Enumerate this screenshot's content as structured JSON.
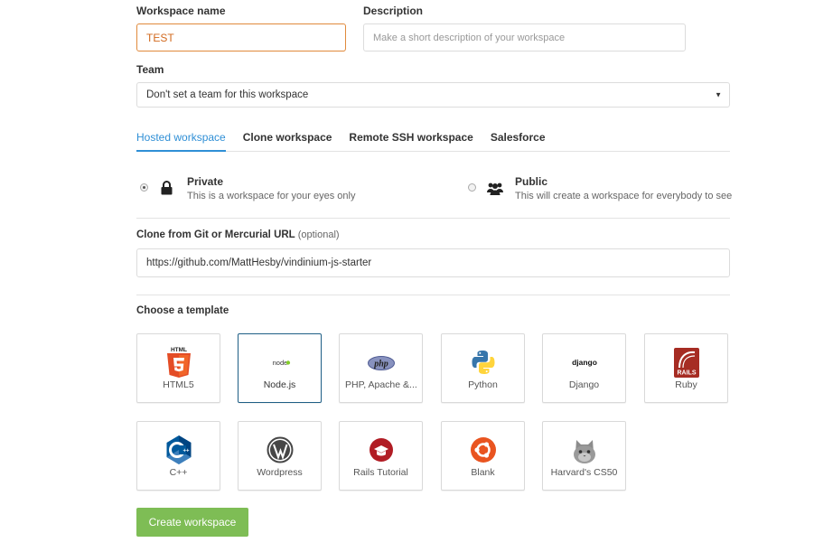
{
  "form": {
    "workspace_name_label": "Workspace name",
    "workspace_name_value": "TEST",
    "description_label": "Description",
    "description_placeholder": "Make a short description of your workspace",
    "team_label": "Team",
    "team_value": "Don't set a team for this workspace"
  },
  "tabs": [
    {
      "label": "Hosted workspace",
      "active": true
    },
    {
      "label": "Clone workspace",
      "active": false
    },
    {
      "label": "Remote SSH workspace",
      "active": false
    },
    {
      "label": "Salesforce",
      "active": false
    }
  ],
  "visibility": {
    "private": {
      "title": "Private",
      "desc": "This is a workspace for your eyes only",
      "icon": "lock-icon",
      "checked": true
    },
    "public": {
      "title": "Public",
      "desc": "This will create a workspace for everybody to see",
      "icon": "users-icon",
      "checked": false
    }
  },
  "clone": {
    "label": "Clone from Git or Mercurial URL",
    "optional": "(optional)",
    "value": "https://github.com/MattHesby/vindinium-js-starter"
  },
  "templates": {
    "label": "Choose a template",
    "items": [
      {
        "name": "HTML5",
        "icon": "html5-icon",
        "selected": false
      },
      {
        "name": "Node.js",
        "icon": "nodejs-icon",
        "selected": true
      },
      {
        "name": "PHP, Apache &...",
        "icon": "php-icon",
        "selected": false
      },
      {
        "name": "Python",
        "icon": "python-icon",
        "selected": false
      },
      {
        "name": "Django",
        "icon": "django-icon",
        "selected": false
      },
      {
        "name": "Ruby",
        "icon": "rails-icon",
        "selected": false
      },
      {
        "name": "C++",
        "icon": "cpp-icon",
        "selected": false
      },
      {
        "name": "Wordpress",
        "icon": "wordpress-icon",
        "selected": false
      },
      {
        "name": "Rails Tutorial",
        "icon": "rails-tutorial-icon",
        "selected": false
      },
      {
        "name": "Blank",
        "icon": "ubuntu-icon",
        "selected": false
      },
      {
        "name": "Harvard's CS50",
        "icon": "cs50-cat-icon",
        "selected": false
      }
    ],
    "icon_text": {
      "html5": "HTML",
      "node": "node",
      "php": "php",
      "django": "django",
      "rails": "RAILS"
    }
  },
  "colors": {
    "accent": "#2f8fd6",
    "create": "#7ebd55",
    "focus": "#e08a3c"
  },
  "create_button": "Create workspace"
}
